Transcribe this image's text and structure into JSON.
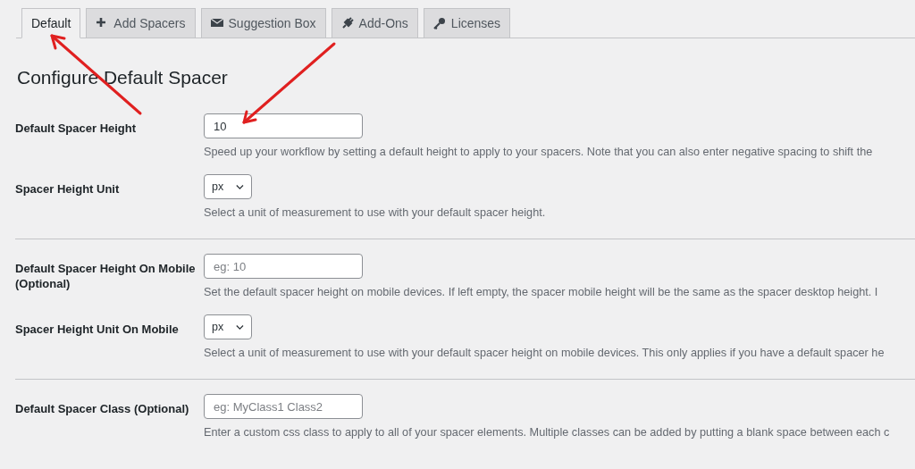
{
  "tabs": [
    {
      "label": "Default",
      "kind": "plain",
      "selected": true
    },
    {
      "label": "Add Spacers",
      "kind": "plus",
      "selected": false
    },
    {
      "label": "Suggestion Box",
      "kind": "envelope",
      "selected": false
    },
    {
      "label": "Add-Ons",
      "kind": "plug",
      "selected": false
    },
    {
      "label": "Licenses",
      "kind": "key",
      "selected": false
    }
  ],
  "heading": "Configure Default Spacer",
  "sections": [
    {
      "rows": [
        {
          "label": "Default Spacer Height",
          "kind": "text",
          "value": "10",
          "description": "Speed up your workflow by setting a default height to apply to your spacers. Note that you can also enter negative spacing to shift the"
        },
        {
          "label": "Spacer Height Unit",
          "kind": "select",
          "value": "px",
          "description": "Select a unit of measurement to use with your default spacer height."
        }
      ]
    },
    {
      "rows": [
        {
          "label": "Default Spacer Height On Mobile (Optional)",
          "kind": "text",
          "placeholder": "eg: 10",
          "description": "Set the default spacer height on mobile devices. If left empty, the spacer mobile height will be the same as the spacer desktop height. I"
        },
        {
          "label": "Spacer Height Unit On Mobile",
          "kind": "select",
          "value": "px",
          "description": "Select a unit of measurement to use with your default spacer height on mobile devices. This only applies if you have a default spacer he"
        }
      ]
    },
    {
      "rows": [
        {
          "label": "Default Spacer Class (Optional)",
          "kind": "text",
          "placeholder": "eg: MyClass1 Class2",
          "description": "Enter a custom css class to apply to all of your spacer elements. Multiple classes can be added by putting a blank space between each c"
        }
      ]
    }
  ]
}
